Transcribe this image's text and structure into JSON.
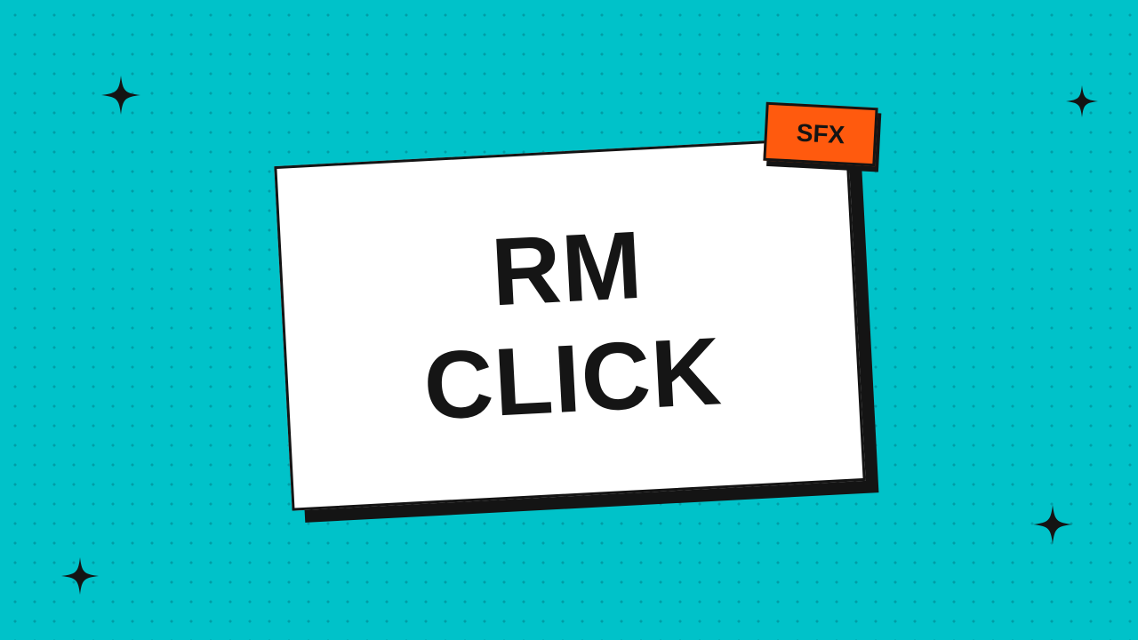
{
  "card": {
    "line1": "RM",
    "line2": "CLICK"
  },
  "badge": {
    "label": "SFX"
  },
  "colors": {
    "background": "#00c2c9",
    "card": "#ffffff",
    "ink": "#141414",
    "badge": "#ff5a0e"
  },
  "decorations": {
    "sparkle_icon": "four-point-star-icon"
  }
}
